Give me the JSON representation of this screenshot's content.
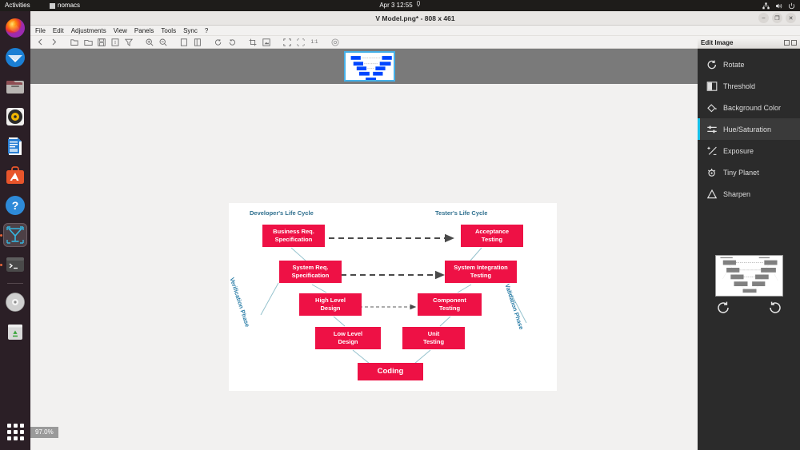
{
  "desktop": {
    "activities_label": "Activities",
    "app_name": "nomacs",
    "clock": "Apr 3  12:55",
    "tray_icons": [
      "network-icon",
      "volume-icon",
      "power-icon"
    ]
  },
  "dock": {
    "items": [
      {
        "name": "firefox",
        "label": "Firefox"
      },
      {
        "name": "thunderbird",
        "label": "Thunderbird"
      },
      {
        "name": "files",
        "label": "Files"
      },
      {
        "name": "rhythmbox",
        "label": "Rhythmbox"
      },
      {
        "name": "libreoffice-writer",
        "label": "LibreOffice Writer"
      },
      {
        "name": "ubuntu-software",
        "label": "Ubuntu Software"
      },
      {
        "name": "help",
        "label": "Help"
      },
      {
        "name": "nomacs",
        "label": "nomacs Image Lounge",
        "running": true,
        "active": true
      },
      {
        "name": "terminal",
        "label": "Terminal",
        "running": true
      },
      {
        "name": "disc",
        "label": "CD/DVD"
      },
      {
        "name": "trash",
        "label": "Trash"
      }
    ],
    "show_apps_label": "Show Applications"
  },
  "window": {
    "title": "V Model.png* - 808 x 461",
    "buttons": {
      "minimize": "–",
      "maximize": "❐",
      "close": "✕"
    }
  },
  "menubar": {
    "items": [
      "File",
      "Edit",
      "Adjustments",
      "View",
      "Panels",
      "Tools",
      "Sync",
      "?"
    ]
  },
  "toolbar": {
    "items": [
      "previous-image-icon",
      "next-image-icon",
      "open-image-icon",
      "open-directory-icon",
      "save-icon",
      "rename-icon",
      "filter-icon",
      "zoom-in-icon",
      "zoom-out-icon",
      "copy-icon",
      "paste-icon",
      "rotate-ccw-icon",
      "rotate-cw-icon",
      "crop-icon",
      "resize-icon",
      "fullscreen-icon",
      "fit-window-icon",
      "zoom-100-icon",
      "settings-icon"
    ],
    "zoom_100_label": "1:1"
  },
  "viewer": {
    "zoom_level": "97.0%",
    "thumbnail_name": "V Model.png"
  },
  "panel": {
    "title": "Edit Image",
    "header_buttons": [
      "undock-icon",
      "close-icon"
    ],
    "items": [
      {
        "label": "Rotate",
        "icon": "rotate-icon",
        "selected": false
      },
      {
        "label": "Threshold",
        "icon": "threshold-icon",
        "selected": false
      },
      {
        "label": "Background Color",
        "icon": "background-color-icon",
        "selected": false
      },
      {
        "label": "Hue/Saturation",
        "icon": "hue-saturation-icon",
        "selected": true
      },
      {
        "label": "Exposure",
        "icon": "exposure-icon",
        "selected": false
      },
      {
        "label": "Tiny Planet",
        "icon": "tiny-planet-icon",
        "selected": false
      },
      {
        "label": "Sharpen",
        "icon": "sharpen-icon",
        "selected": false
      }
    ],
    "rotate_ccw_label": "rotate-counter-clockwise-icon",
    "rotate_cw_label": "rotate-clockwise-icon",
    "accent_color": "#17c0e8"
  },
  "diagram": {
    "title_left": "Developer's Life Cycle",
    "title_right": "Tester's Life Cycle",
    "phase_left": "Verification Phase",
    "phase_right": "Validation Phase",
    "box_color": "#ee1145",
    "heading_color": "#2e6f8e",
    "boxes": {
      "business_req": "Business Req.\nSpecification",
      "business_req_l1": "Business Req.",
      "business_req_l2": "Specification",
      "acceptance": "Acceptance Testing",
      "acceptance_l1": "Acceptance",
      "acceptance_l2": "Testing",
      "system_req_l1": "System Req.",
      "system_req_l2": "Specification",
      "system_integration_l1": "System Integration",
      "system_integration_l2": "Testing",
      "high_level_l1": "High Level",
      "high_level_l2": "Design",
      "component_l1": "Component",
      "component_l2": "Testing",
      "low_level_l1": "Low Level",
      "low_level_l2": "Design",
      "unit_l1": "Unit",
      "unit_l2": "Testing",
      "coding": "Coding"
    }
  }
}
